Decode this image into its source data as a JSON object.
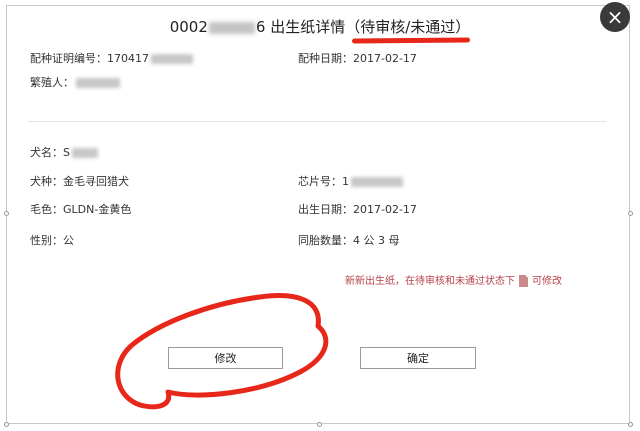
{
  "dialog": {
    "title_prefix": "0002",
    "title_suffix": "6 出生纸详情",
    "status": "（待审核/未通过）",
    "close_glyph": "×"
  },
  "breeding": {
    "cert_label": "配种证明编号：",
    "cert_value": "170417",
    "date_label": "配种日期：",
    "date_value": "2017-02-17",
    "breeder_label": "繁殖人："
  },
  "dog": {
    "name_label": "犬名：",
    "name_value": "S",
    "breed_label": "犬种：",
    "breed_value": "金毛寻回猎犬",
    "chip_label": "芯片号：",
    "chip_value": "1",
    "color_label": "毛色：",
    "color_value": "GLDN-金黄色",
    "birth_label": "出生日期：",
    "birth_value": "2017-02-17",
    "sex_label": "性别：",
    "sex_value": "公",
    "litter_label": "同胎数量：",
    "litter_value": "4 公  3  母"
  },
  "note": {
    "text_before": "新新出生纸，在待审核和未通过状态下",
    "text_after": "可修改"
  },
  "buttons": {
    "edit_label": "修改",
    "confirm_label": "确定"
  },
  "colors": {
    "annotation_red": "#e8271b",
    "note_text": "#b5434a",
    "close_bg": "#3a3a3a"
  }
}
